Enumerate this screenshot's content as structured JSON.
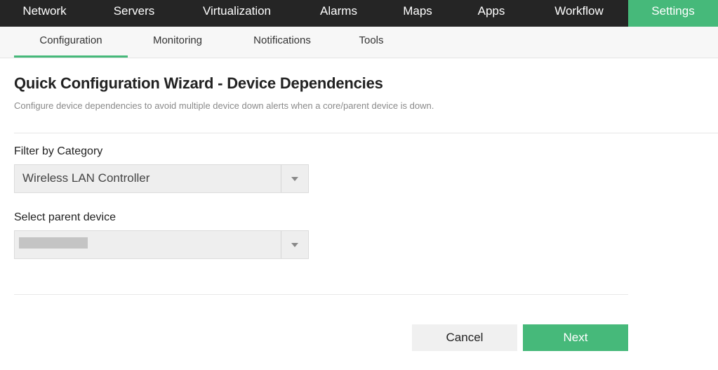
{
  "topnav": {
    "items": [
      {
        "label": "Network"
      },
      {
        "label": "Servers"
      },
      {
        "label": "Virtualization"
      },
      {
        "label": "Alarms"
      },
      {
        "label": "Maps"
      },
      {
        "label": "Apps"
      },
      {
        "label": "Workflow"
      },
      {
        "label": "Settings",
        "active": true
      }
    ]
  },
  "subnav": {
    "tabs": [
      {
        "label": "Configuration",
        "active": true
      },
      {
        "label": "Monitoring"
      },
      {
        "label": "Notifications"
      },
      {
        "label": "Tools"
      }
    ]
  },
  "page": {
    "title": "Quick Configuration Wizard - Device Dependencies",
    "description": "Configure device dependencies to avoid multiple device down alerts when a core/parent device is down."
  },
  "form": {
    "category_label": "Filter by Category",
    "category_value": "Wireless LAN Controller",
    "parent_label": "Select parent device",
    "parent_value": "",
    "parent_value_redacted": true
  },
  "actions": {
    "cancel_label": "Cancel",
    "next_label": "Next"
  },
  "colors": {
    "accent": "#46b97a",
    "topnav_bg": "#252525"
  },
  "icons": {
    "dropdown": "chevron-down-icon"
  }
}
